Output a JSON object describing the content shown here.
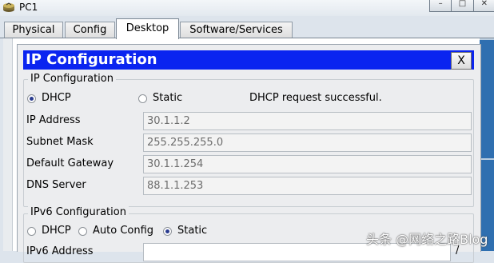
{
  "window": {
    "title": "PC1",
    "buttons": [
      "–",
      "□",
      "✕"
    ]
  },
  "tabs": [
    {
      "label": "Physical",
      "active": false
    },
    {
      "label": "Config",
      "active": false
    },
    {
      "label": "Desktop",
      "active": true
    },
    {
      "label": "Software/Services",
      "active": false
    }
  ],
  "dialog": {
    "title": "IP Configuration",
    "close_label": "X",
    "ipv4": {
      "legend": "IP Configuration",
      "dhcp_label": "DHCP",
      "static_label": "Static",
      "mode": "DHCP",
      "status": "DHCP request successful.",
      "fields": [
        {
          "label": "IP Address",
          "value": "30.1.1.2"
        },
        {
          "label": "Subnet Mask",
          "value": "255.255.255.0"
        },
        {
          "label": "Default Gateway",
          "value": "30.1.1.254"
        },
        {
          "label": "DNS Server",
          "value": "88.1.1.253"
        }
      ]
    },
    "ipv6": {
      "legend": "IPv6 Configuration",
      "dhcp_label": "DHCP",
      "autoconfig_label": "Auto Config",
      "static_label": "Static",
      "mode": "Static",
      "address_label": "IPv6 Address",
      "address_suffix": "/"
    }
  },
  "watermark": "头条 @网络之路Blog",
  "colors": {
    "dialog_title_bg": "#0a24f0",
    "desktop_accent": "#2f6fb0"
  },
  "icons": {
    "app": "router-icon",
    "radio": "radio-button"
  }
}
